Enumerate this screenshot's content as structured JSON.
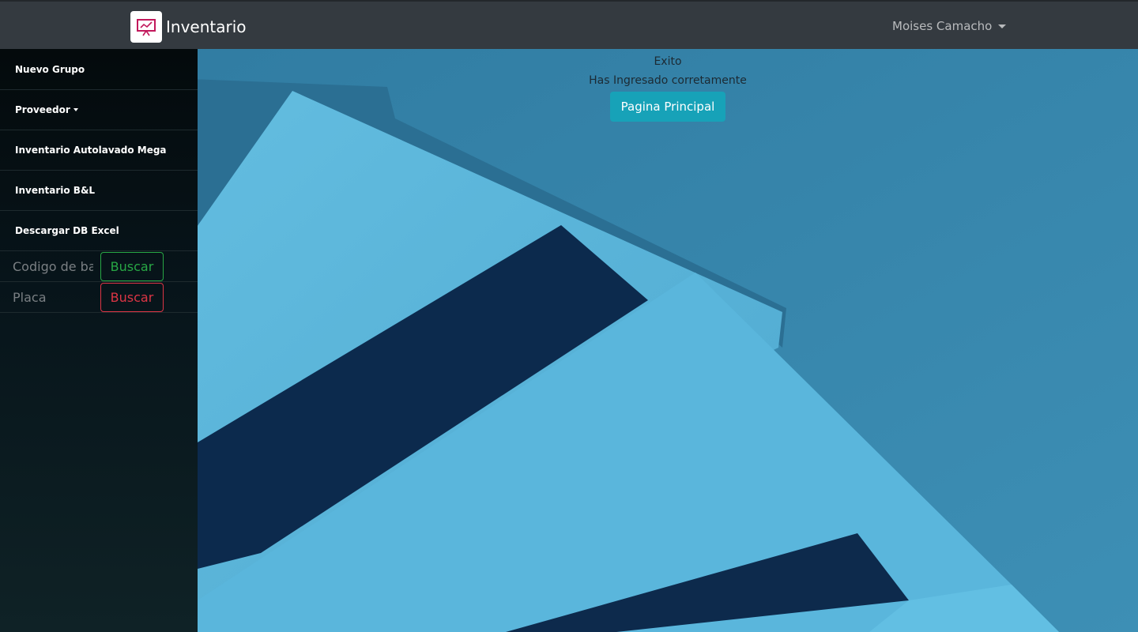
{
  "navbar": {
    "brand": "Inventario",
    "user_name": "Moises Camacho"
  },
  "sidebar": {
    "items": [
      {
        "label": "Nuevo Grupo"
      },
      {
        "label": "Proveedor"
      },
      {
        "label": "Inventario Autolavado Mega"
      },
      {
        "label": "Inventario B&L"
      },
      {
        "label": "Descargar DB Excel"
      }
    ],
    "barcode_search": {
      "placeholder": "Codigo de barras",
      "button": "Buscar"
    },
    "plate_search": {
      "placeholder": "Placa",
      "button": "Buscar"
    }
  },
  "main": {
    "status_title": "Exito",
    "status_message": "Has Ingresado corretamente",
    "home_button": "Pagina Principal"
  },
  "colors": {
    "navbar": "#343a40",
    "success": "#28a745",
    "danger": "#dc3545",
    "info": "#17a2b8",
    "logo_accent": "#c2185b"
  }
}
